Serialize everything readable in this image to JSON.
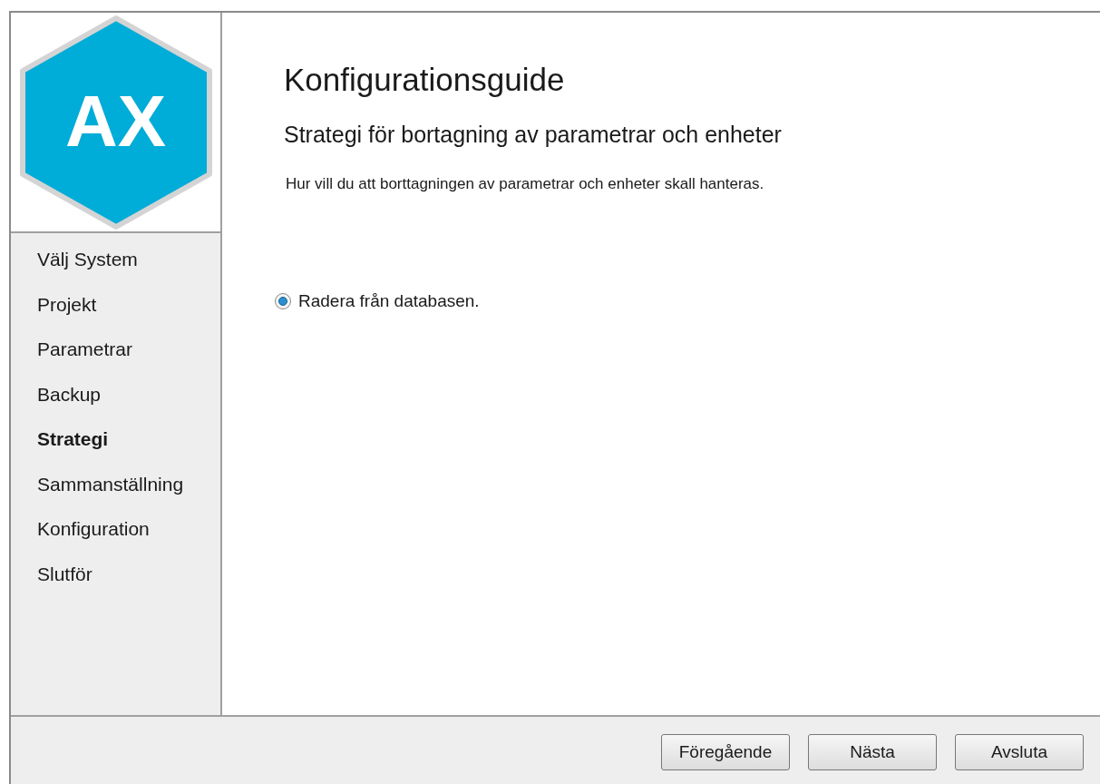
{
  "logo": {
    "text": "AX"
  },
  "sidebar": {
    "items": [
      {
        "label": "Välj System",
        "selected": false
      },
      {
        "label": "Projekt",
        "selected": false
      },
      {
        "label": "Parametrar",
        "selected": false
      },
      {
        "label": "Backup",
        "selected": false
      },
      {
        "label": "Strategi",
        "selected": true
      },
      {
        "label": "Sammanställning",
        "selected": false
      },
      {
        "label": "Konfiguration",
        "selected": false
      },
      {
        "label": "Slutför",
        "selected": false
      }
    ]
  },
  "title": "Konfigurationsguide",
  "subtitle": "Strategi för bortagning av parametrar och enheter",
  "description": "Hur vill du att borttagningen av parametrar och enheter skall hanteras.",
  "options": [
    {
      "label": "Radera från databasen.",
      "selected": true
    }
  ],
  "buttons": [
    "Föregående",
    "Nästa",
    "Avsluta"
  ]
}
